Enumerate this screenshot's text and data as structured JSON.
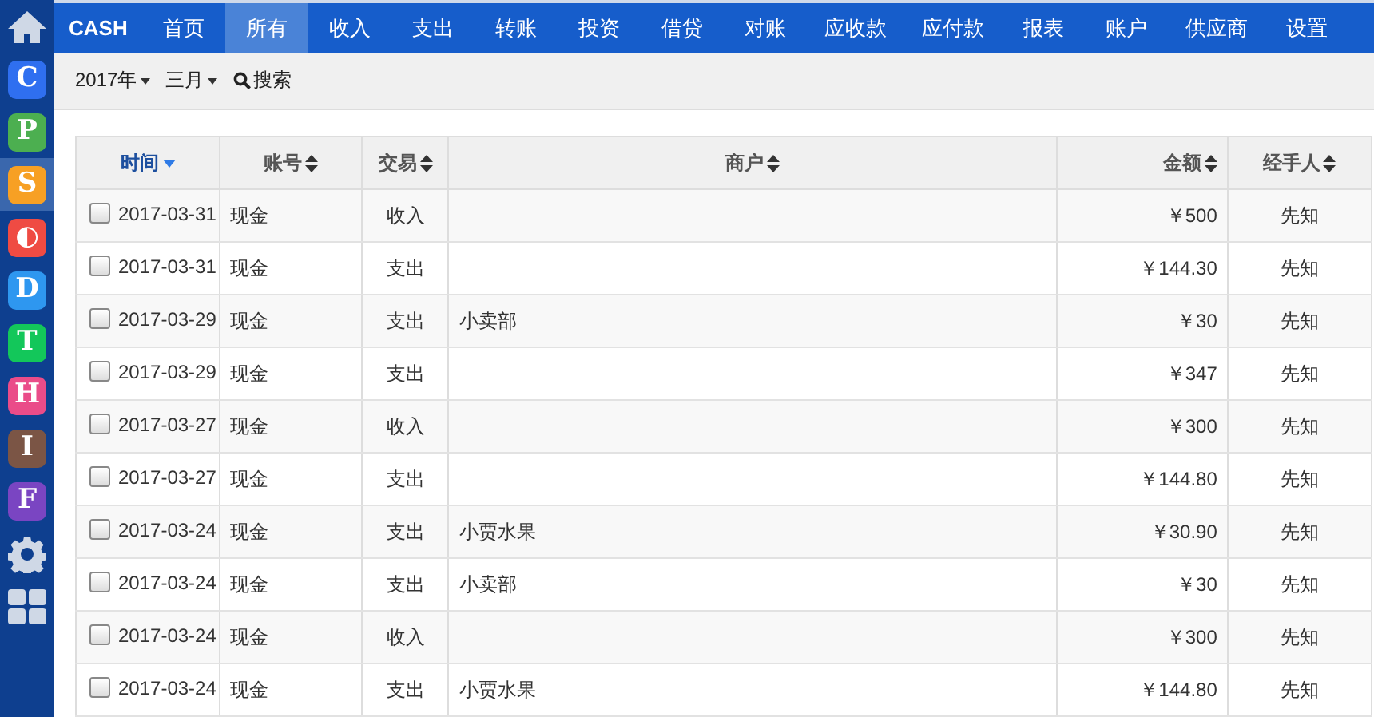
{
  "sidebar": {
    "apps": [
      {
        "letter": "C",
        "color": "#2f6ff0",
        "selected": false
      },
      {
        "letter": "P",
        "color": "#4caf50",
        "selected": false
      },
      {
        "letter": "S",
        "color": "#f7a024",
        "selected": true
      },
      {
        "letter": "◐",
        "color": "#ef4b43",
        "selected": false
      },
      {
        "letter": "D",
        "color": "#2e97f0",
        "selected": false
      },
      {
        "letter": "T",
        "color": "#13c75a",
        "selected": false
      },
      {
        "letter": "H",
        "color": "#ea4c89",
        "selected": false
      },
      {
        "letter": "I",
        "color": "#7b5545",
        "selected": false
      },
      {
        "letter": "F",
        "color": "#7a45c2",
        "selected": false
      }
    ]
  },
  "nav": {
    "brand": "CASH",
    "tabs": [
      {
        "label": "首页",
        "selected": false
      },
      {
        "label": "所有",
        "selected": true
      },
      {
        "label": "收入",
        "selected": false
      },
      {
        "label": "支出",
        "selected": false
      },
      {
        "label": "转账",
        "selected": false
      },
      {
        "label": "投资",
        "selected": false
      },
      {
        "label": "借贷",
        "selected": false
      },
      {
        "label": "对账",
        "selected": false
      },
      {
        "label": "应收款",
        "selected": false
      },
      {
        "label": "应付款",
        "selected": false
      },
      {
        "label": "报表",
        "selected": false
      },
      {
        "label": "账户",
        "selected": false
      },
      {
        "label": "供应商",
        "selected": false
      },
      {
        "label": "设置",
        "selected": false
      }
    ]
  },
  "toolbar": {
    "year": "2017年",
    "month": "三月",
    "search": "搜索"
  },
  "table": {
    "columns": [
      {
        "label": "时间",
        "sorted": true
      },
      {
        "label": "账号",
        "sorted": false
      },
      {
        "label": "交易",
        "sorted": false
      },
      {
        "label": "商户",
        "sorted": false
      },
      {
        "label": "金额",
        "sorted": false
      },
      {
        "label": "经手人",
        "sorted": false
      }
    ],
    "rows": [
      {
        "checked": false,
        "cells": [
          "2017-03-31",
          "现金",
          "收入",
          "",
          "￥500",
          "先知"
        ]
      },
      {
        "checked": false,
        "cells": [
          "2017-03-31",
          "现金",
          "支出",
          "",
          "￥144.30",
          "先知"
        ]
      },
      {
        "checked": false,
        "cells": [
          "2017-03-29",
          "现金",
          "支出",
          "小卖部",
          "￥30",
          "先知"
        ]
      },
      {
        "checked": false,
        "cells": [
          "2017-03-29",
          "现金",
          "支出",
          "",
          "￥347",
          "先知"
        ]
      },
      {
        "checked": false,
        "cells": [
          "2017-03-27",
          "现金",
          "收入",
          "",
          "￥300",
          "先知"
        ]
      },
      {
        "checked": false,
        "cells": [
          "2017-03-27",
          "现金",
          "支出",
          "",
          "￥144.80",
          "先知"
        ]
      },
      {
        "checked": false,
        "cells": [
          "2017-03-24",
          "现金",
          "支出",
          "小贾水果",
          "￥30.90",
          "先知"
        ]
      },
      {
        "checked": false,
        "cells": [
          "2017-03-24",
          "现金",
          "支出",
          "小卖部",
          "￥30",
          "先知"
        ]
      },
      {
        "checked": false,
        "cells": [
          "2017-03-24",
          "现金",
          "收入",
          "",
          "￥300",
          "先知"
        ]
      },
      {
        "checked": false,
        "cells": [
          "2017-03-24",
          "现金",
          "支出",
          "小贾水果",
          "￥144.80",
          "先知"
        ]
      }
    ]
  }
}
